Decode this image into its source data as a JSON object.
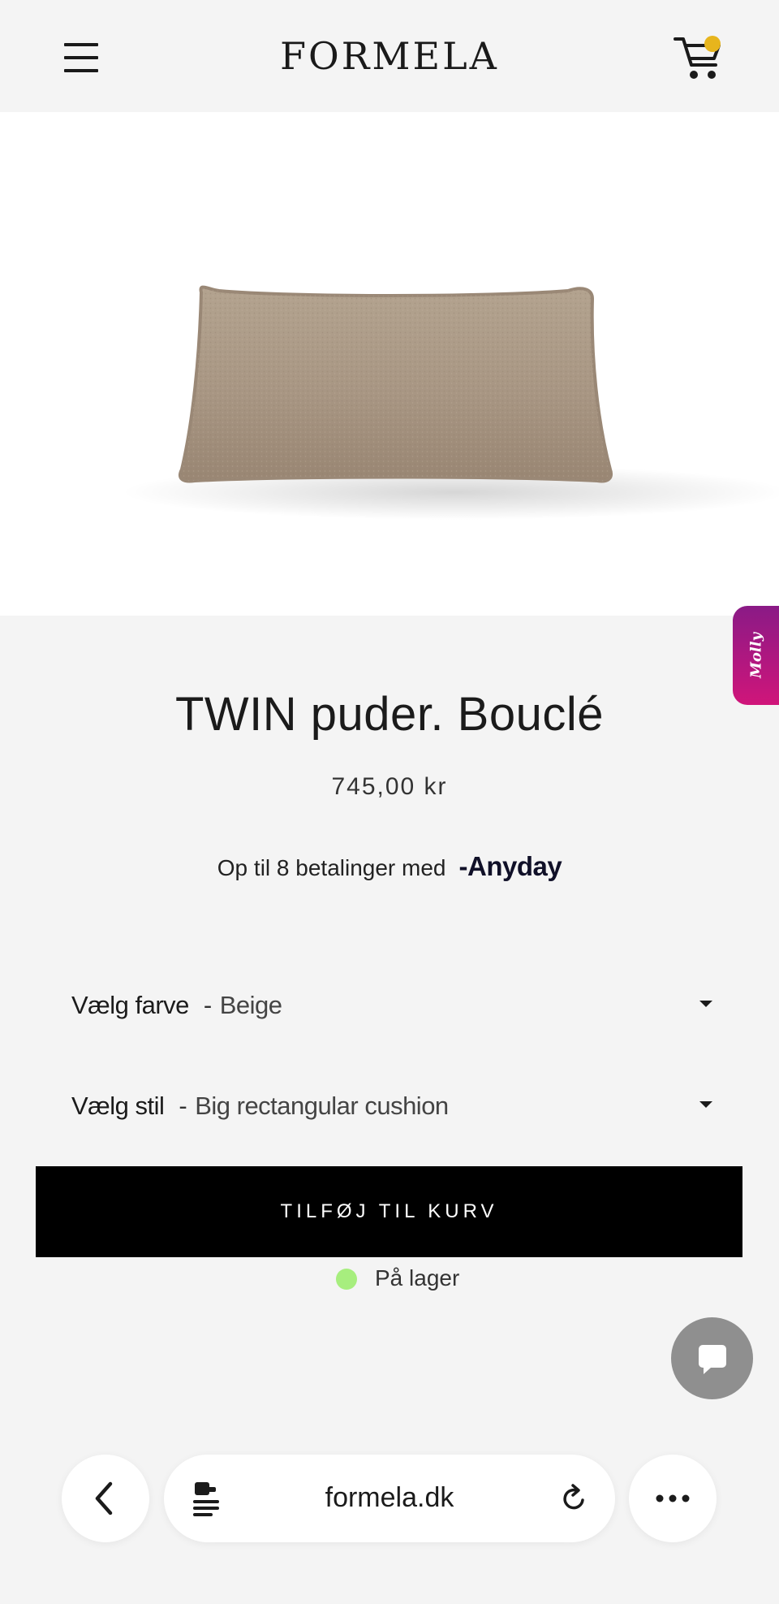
{
  "header": {
    "logo": "FORMELA",
    "menu_icon": "hamburger-menu-icon",
    "cart_icon": "shopping-cart-icon",
    "cart_badge_color": "#e7b51d"
  },
  "side_tab": {
    "label": "Molly"
  },
  "product": {
    "image_alt": "beige bouclé rectangular cushion",
    "title": "TWIN puder. Bouclé",
    "price": "745,00 kr",
    "payment_text": "Op til 8 betalinger med",
    "payment_brand": "-Anyday",
    "options": [
      {
        "label": "Vælg farve",
        "separator": "-",
        "value": "Beige"
      },
      {
        "label": "Vælg stil",
        "separator": "-",
        "value": "Big rectangular cushion"
      }
    ],
    "add_to_cart_label": "TILFØJ TIL KURV",
    "stock_label": "På lager",
    "stock_color": "#a7ee7e"
  },
  "chat": {
    "icon": "chat-bubble-icon"
  },
  "browser": {
    "url": "formela.dk",
    "back_icon": "chevron-left-icon",
    "page_icon": "page-menu-icon",
    "reload_icon": "reload-icon",
    "more_icon": "more-dots-icon"
  }
}
